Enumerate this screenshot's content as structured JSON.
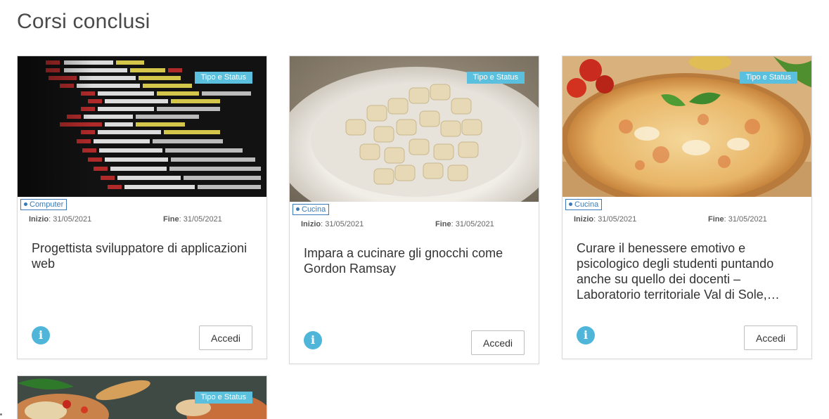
{
  "page": {
    "title": "Corsi conclusi"
  },
  "cards": [
    {
      "status": "Tipo e Status",
      "category": "Computer",
      "start_label": "Inizio",
      "start_date": "31/05/2021",
      "end_label": "Fine",
      "end_date": "31/05/2021",
      "title": "Progettista sviluppatore di applicazioni web",
      "info_icon": "info-icon",
      "button_label": "Accedi",
      "image": "code-editor-screen"
    },
    {
      "status": "Tipo e Status",
      "category": "Cucina",
      "start_label": "Inizio",
      "start_date": "31/05/2021",
      "end_label": "Fine",
      "end_date": "31/05/2021",
      "title": "Impara a cucinare gli gnocchi come Gordon Ramsay",
      "info_icon": "info-icon",
      "button_label": "Accedi",
      "image": "gnocchi-plate"
    },
    {
      "status": "Tipo e Status",
      "category": "Cucina",
      "start_label": "Inizio",
      "start_date": "31/05/2021",
      "end_label": "Fine",
      "end_date": "31/05/2021",
      "title": "Curare il benessere emotivo e psicologico degli studenti puntando anche su quello dei docenti – Laboratorio territoriale Val di Sole,…",
      "info_icon": "info-icon",
      "button_label": "Accedi",
      "image": "pizza-margherita"
    },
    {
      "status": "Tipo e Status",
      "image": "food-dish"
    }
  ],
  "colors": {
    "accent": "#5bc0de",
    "category": "#3a7ab8",
    "info": "#4fb6d9"
  }
}
